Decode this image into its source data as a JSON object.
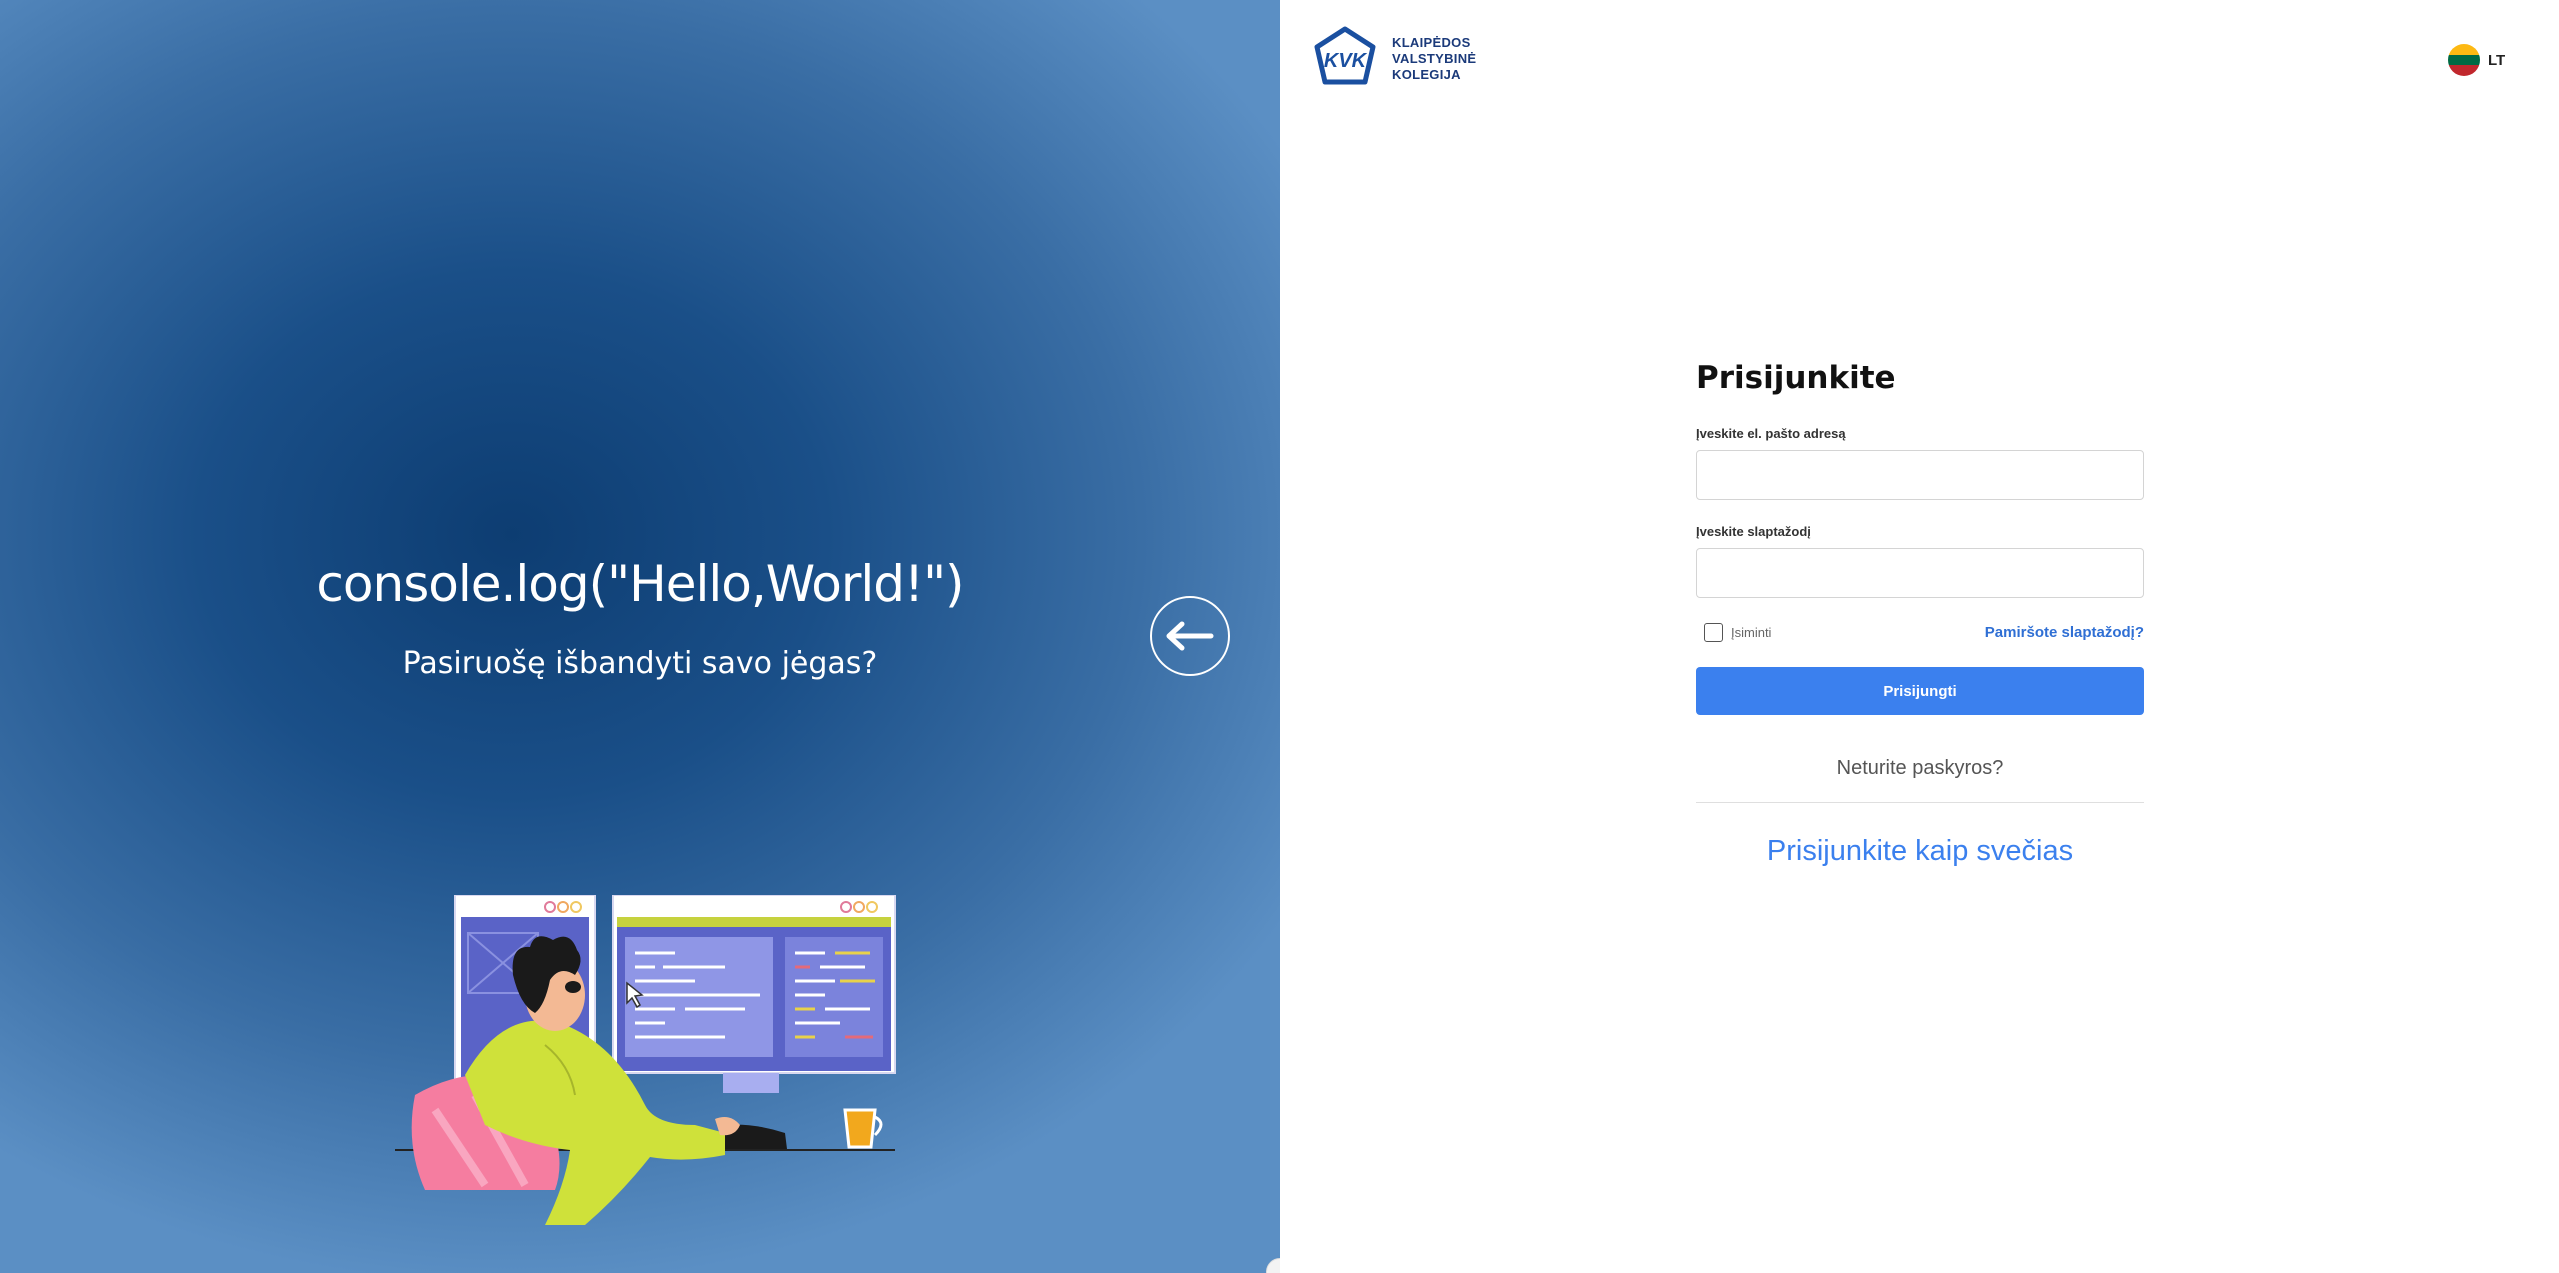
{
  "hero": {
    "title": "console.log(\"Hello,World!\")",
    "subtitle": "Pasiruošę išbandyti savo jėgas?"
  },
  "logo": {
    "mark": "KVK",
    "line1": "KLAIPĖDOS",
    "line2": "VALSTYBINĖ",
    "line3": "KOLEGIJA"
  },
  "language": {
    "code": "LT",
    "flag_colors": [
      "#fdb913",
      "#006a44",
      "#c1272d"
    ]
  },
  "login": {
    "title": "Prisijunkite",
    "email_label": "Įveskite el. pašto adresą",
    "email_value": "",
    "password_label": "Įveskite slaptažodį",
    "password_value": "",
    "remember_label": "Įsiminti",
    "remember_checked": false,
    "forgot_label": "Pamiršote slaptažodį?",
    "submit_label": "Prisijungti",
    "no_account": "Neturite paskyros?",
    "guest_label": "Prisijunkite kaip svečias"
  },
  "icons": {
    "back": "arrow-left-icon",
    "flag": "lithuania-flag-icon"
  },
  "colors": {
    "primary": "#3b80ee",
    "link": "#2f6fd4",
    "hero_dark": "#0d3d72",
    "hero_light": "#5b8fc4"
  }
}
